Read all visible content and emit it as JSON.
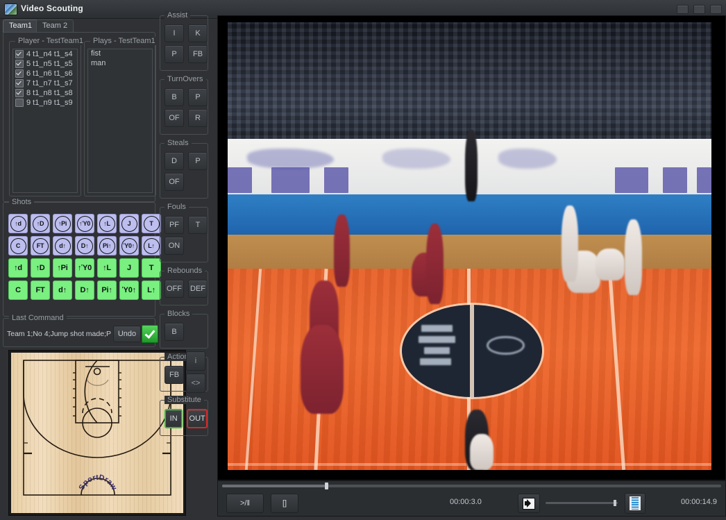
{
  "window": {
    "title": "Video Scouting",
    "icon": "app-icon",
    "buttons": [
      "minimize",
      "maximize",
      "close"
    ]
  },
  "tabs": [
    {
      "label": "Team1",
      "active": true
    },
    {
      "label": "Team 2",
      "active": false
    }
  ],
  "player_panel": {
    "label": "Player - TestTeam1",
    "items": [
      {
        "label": "4 t1_n4 t1_s4",
        "checked": true
      },
      {
        "label": "5 t1_n5 t1_s5",
        "checked": true
      },
      {
        "label": "6 t1_n6 t1_s6",
        "checked": true
      },
      {
        "label": "7 t1_n7 t1_s7",
        "checked": true
      },
      {
        "label": "8 t1_n8 t1_s8",
        "checked": true
      },
      {
        "label": "9 t1_n9 t1_s9",
        "checked": false
      }
    ]
  },
  "plays_panel": {
    "label": "Plays - TestTeam1",
    "items": [
      "fist",
      "man"
    ]
  },
  "shots": {
    "label": "Shots",
    "rows": [
      {
        "style": "lavender-circle",
        "buttons": [
          "↑d",
          "↑D",
          "↑Pi",
          "↑Ὑ0",
          "↑L",
          "J",
          "T"
        ]
      },
      {
        "style": "lavender-circle",
        "buttons": [
          "C",
          "FT",
          "d↑",
          "D↑",
          "Pi↑",
          "Ὑ0↑",
          "L↑"
        ]
      },
      {
        "style": "green-flat",
        "buttons": [
          "↑d",
          "↑D",
          "↑Pi",
          "↑Ὑ0",
          "↑L",
          "J",
          "T"
        ]
      },
      {
        "style": "green-flat",
        "buttons": [
          "C",
          "FT",
          "d↑",
          "D↑",
          "Pi↑",
          "Ὑ0↑",
          "L↑"
        ]
      }
    ]
  },
  "last_command": {
    "label": "Last Command",
    "text": "Team 1;No 4;Jump shot made;P",
    "undo_label": "Undo",
    "confirm_icon": "checkmark-icon"
  },
  "court": {
    "watermark": "SportDraw"
  },
  "groups": [
    {
      "label": "Assist",
      "buttons": [
        "I",
        "K",
        "P",
        "FB"
      ]
    },
    {
      "label": "TurnOvers",
      "buttons": [
        "B",
        "P",
        "OF",
        "R"
      ]
    },
    {
      "label": "Steals",
      "buttons": [
        "D",
        "P",
        "OF"
      ]
    },
    {
      "label": "Fouls",
      "buttons": [
        "PF",
        "T",
        "ON"
      ]
    },
    {
      "label": "Rebounds",
      "buttons": [
        "OFF",
        "DEF"
      ]
    },
    {
      "label": "Blocks",
      "buttons": [
        "B"
      ]
    },
    {
      "label": "Action",
      "buttons": [
        "FB"
      ]
    },
    {
      "label": "Substitute",
      "buttons": [
        "IN",
        "OUT"
      ]
    }
  ],
  "side_buttons": [
    {
      "label": "i",
      "name": "info-button"
    },
    {
      "label": "<>",
      "name": "code-button"
    }
  ],
  "transport": {
    "play_label": ">/‖",
    "stop_label": "[]",
    "speaker_icon": "speaker-icon",
    "film_icon": "film-strip-icon",
    "current_time": "00:00:3.0",
    "total_time": "00:00:14.9",
    "seek_percent": 20.6,
    "volume_percent": 94
  },
  "colors": {
    "accent_green": "#79f07f",
    "accent_lavender": "#bdbdee",
    "in_border": "#2fbf3a",
    "out_border": "#cf2b2b",
    "panel_bg": "#2f3134"
  }
}
